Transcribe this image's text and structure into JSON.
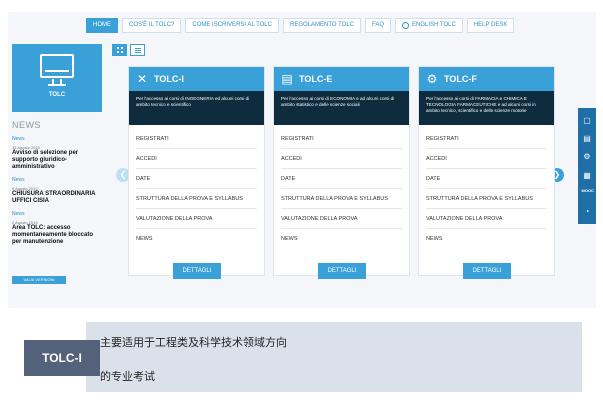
{
  "nav": {
    "items": [
      "HOME",
      "COS'È IL TOLC?",
      "COME ISCRIVERSI AL TOLC",
      "REGOLAMENTO TOLC",
      "FAQ",
      "ENGLISH TOLC",
      "HELP DESK"
    ],
    "active_index": 0
  },
  "logo": {
    "label": "TOLC"
  },
  "news": {
    "heading": "NEWS",
    "items": [
      {
        "category": "News",
        "date": "12 Agosto 2019",
        "title": "Avviso di selezione per supporto giuridico-amministrativo"
      },
      {
        "category": "News",
        "date": "9 Agosto 2019",
        "title": "CHIUSURA STRAORDINARIA UFFICI CISIA"
      },
      {
        "category": "News",
        "date": "2 Agosto 2019",
        "title": "Area TOLC: accesso momentaneamente bloccato per manutenzione"
      }
    ],
    "more_label": "VAI AI VERSIONI"
  },
  "cards": [
    {
      "name": "TOLC-I",
      "icon": "tools-icon",
      "description": "Per l'accesso ai corsi di INGEGNERIA ed alcuni corsi di ambito tecnico e scientifico",
      "links": [
        "REGISTRATI",
        "ACCEDI",
        "DATE",
        "STRUTTURA DELLA PROVA E SYLLABUS",
        "VALUTAZIONE DELLA PROVA",
        "NEWS"
      ],
      "button": "DETTAGLI"
    },
    {
      "name": "TOLC-E",
      "icon": "bar-chart-icon",
      "description": "Per l'accesso ai corsi di ECONOMIA e ad alcuni corsi di ambito statistico e delle scienze sociali",
      "links": [
        "REGISTRATI",
        "ACCEDI",
        "DATE",
        "STRUTTURA DELLA PROVA E SYLLABUS",
        "VALUTAZIONE DELLA PROVA",
        "NEWS"
      ],
      "button": "DETTAGLI"
    },
    {
      "name": "TOLC-F",
      "icon": "gear-icon",
      "description": "Per l'accesso ai corsi di FARMACIA e CHIMICA E TECNOLOGIA FARMACEUTICHE e ad alcuni corsi in ambito tecnico, scientifico e delle scienze motorie",
      "links": [
        "REGISTRATI",
        "ACCEDI",
        "DATE",
        "STRUTTURA DELLA PROVA E SYLLABUS",
        "VALUTAZIONE DELLA PROVA",
        "NEWS"
      ],
      "button": "DETTAGLI"
    }
  ],
  "side_tools": [
    "monitor-icon",
    "document-icon",
    "gear-icon",
    "building-icon",
    "MOOC",
    "pie-chart-icon"
  ],
  "caption": {
    "tag": "TOLC-I",
    "line1": "主要适用于工程类及科学技术领域方向",
    "line2": "的专业考试"
  },
  "colors": {
    "accent": "#3aa1d8",
    "dark_band": "#0f2c3f",
    "tag_bg": "#53627a",
    "caption_bg": "#dbe1ea"
  }
}
